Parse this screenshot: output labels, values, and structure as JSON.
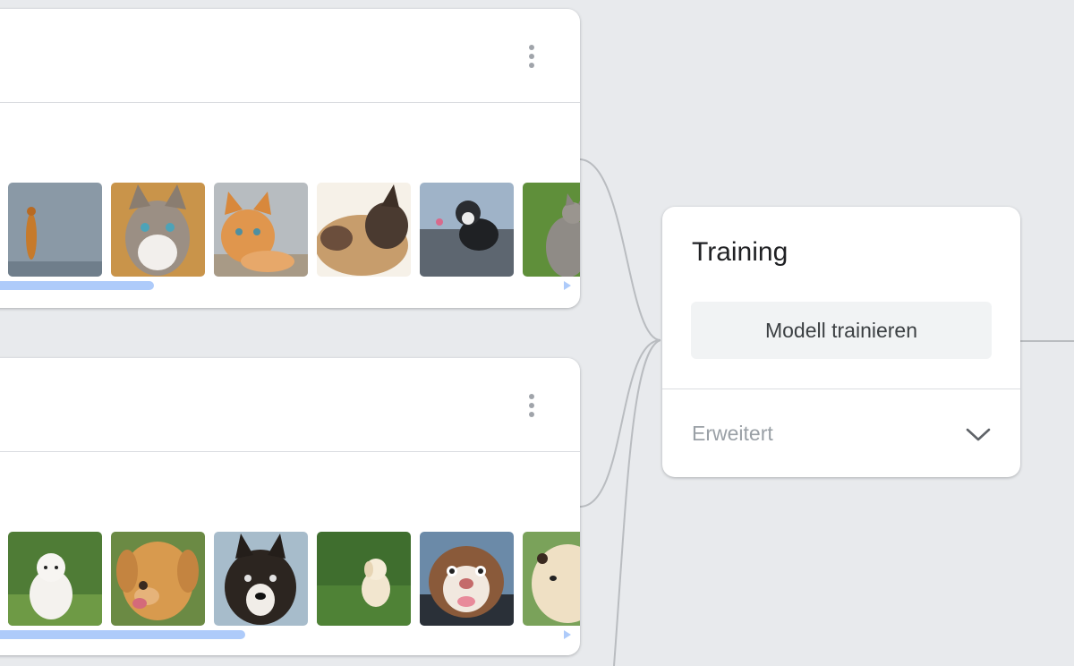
{
  "classes": [
    {
      "id": "cats",
      "menu_icon": "more-vert-icon",
      "images": [
        {
          "name": "cat-image-1",
          "kind": "cat"
        },
        {
          "name": "cat-image-2",
          "kind": "cat"
        },
        {
          "name": "cat-image-3",
          "kind": "cat"
        },
        {
          "name": "cat-image-4",
          "kind": "cat"
        },
        {
          "name": "cat-image-5",
          "kind": "cat"
        },
        {
          "name": "cat-image-6",
          "kind": "cat"
        }
      ],
      "scroll_fraction": 0.3
    },
    {
      "id": "dogs",
      "menu_icon": "more-vert-icon",
      "images": [
        {
          "name": "dog-image-1",
          "kind": "dog"
        },
        {
          "name": "dog-image-2",
          "kind": "dog"
        },
        {
          "name": "dog-image-3",
          "kind": "dog"
        },
        {
          "name": "dog-image-4",
          "kind": "dog"
        },
        {
          "name": "dog-image-5",
          "kind": "dog"
        },
        {
          "name": "dog-image-6",
          "kind": "dog"
        }
      ],
      "scroll_fraction": 0.46
    }
  ],
  "training": {
    "title": "Training",
    "train_button_label": "Modell trainieren",
    "advanced_label": "Erweitert",
    "advanced_icon": "chevron-down-icon"
  },
  "colors": {
    "background": "#e8eaed",
    "scrollbar": "#aecbfa",
    "connector": "#b9bcc0"
  }
}
